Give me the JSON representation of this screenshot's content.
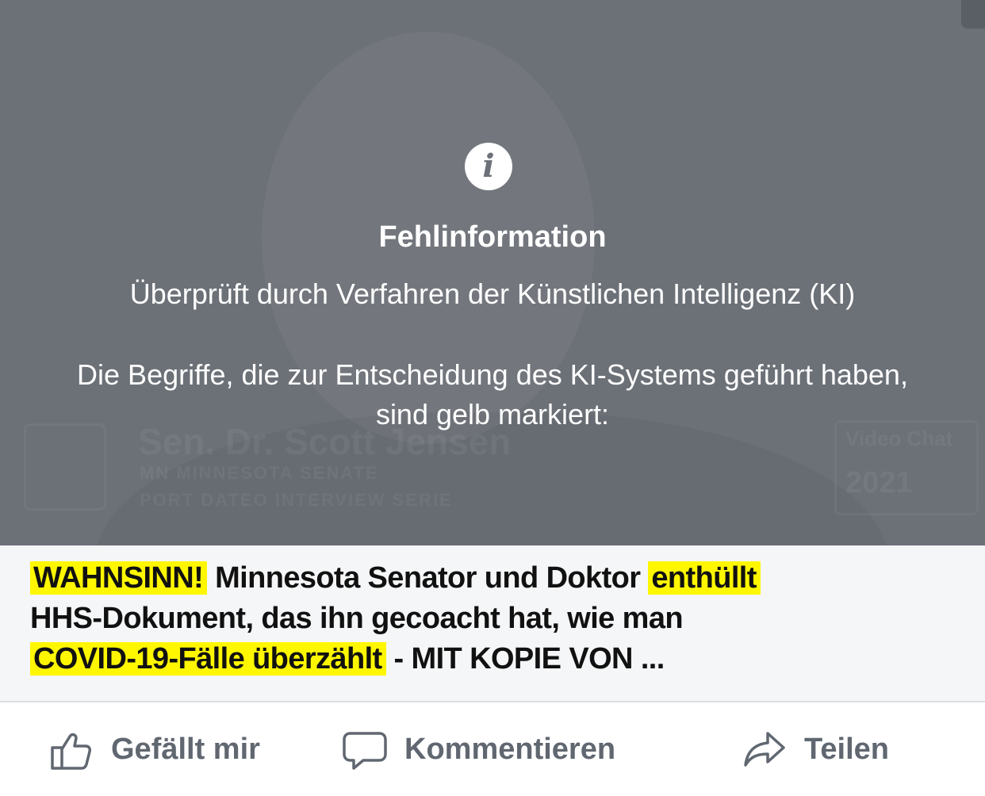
{
  "overlay": {
    "title": "Fehlinformation",
    "subtitle": "Überprüft durch Verfahren der Künstlichen Intelligenz (KI)",
    "explanation_line1": "Die Begriffe, die zur Entscheidung des KI-Systems geführt haben,",
    "explanation_line2": "sind gelb markiert:",
    "icon": "info-icon",
    "background_text": {
      "name": "Sen. Dr. Scott Jensen",
      "line1": "MN MINNESOTA SENATE",
      "line2": "PORT DATEO INTERVIEW SERIE",
      "badge_top": "Video Chat",
      "badge_year": "2021"
    }
  },
  "headline": {
    "seg1": "WAHNSINN!",
    "seg2": " Minnesota Senator und Doktor ",
    "seg3": "enthüllt",
    "seg4": " HHS-Dokument, das ihn gecoacht hat, wie man ",
    "seg5": "COVID-19-Fälle überzählt",
    "seg6": " - MIT KOPIE VON ...",
    "highlight_color": "#fff700"
  },
  "actions": {
    "like": {
      "label": "Gefällt mir",
      "icon": "thumbs-up-icon"
    },
    "comment": {
      "label": "Kommentieren",
      "icon": "comment-icon"
    },
    "share": {
      "label": "Teilen",
      "icon": "share-icon"
    }
  },
  "colors": {
    "overlay_bg": "#6c7077",
    "headline_bg": "#f5f6f7",
    "action_text": "#606770"
  }
}
